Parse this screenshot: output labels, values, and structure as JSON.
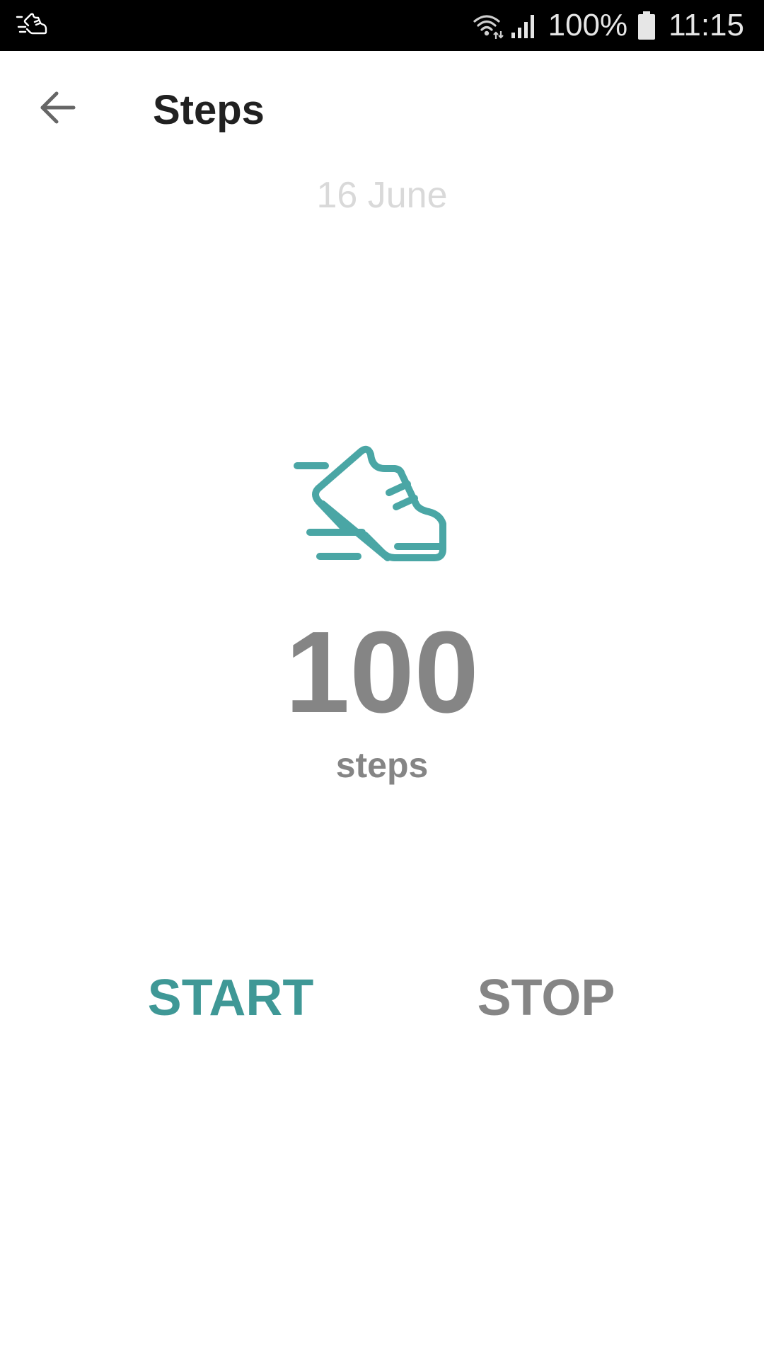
{
  "status_bar": {
    "left_icon": "shoe-notification-icon",
    "wifi_icon": "wifi-icon",
    "signal_icon": "cell-signal-icon",
    "battery_percent": "100%",
    "battery_icon": "battery-icon",
    "time": "11:15"
  },
  "header": {
    "back_icon": "arrow-back-icon",
    "title": "Steps"
  },
  "main": {
    "date": "16 June",
    "hero_icon": "running-shoe-icon",
    "step_count": "100",
    "step_unit": "steps"
  },
  "controls": {
    "start_label": "START",
    "stop_label": "STOP"
  },
  "colors": {
    "accent": "#3f9896",
    "icon_teal": "#4aa6a5",
    "muted_text": "#858585",
    "date_text": "#d9d9d9",
    "title_text": "#212121",
    "status_bar_bg": "#000000"
  }
}
